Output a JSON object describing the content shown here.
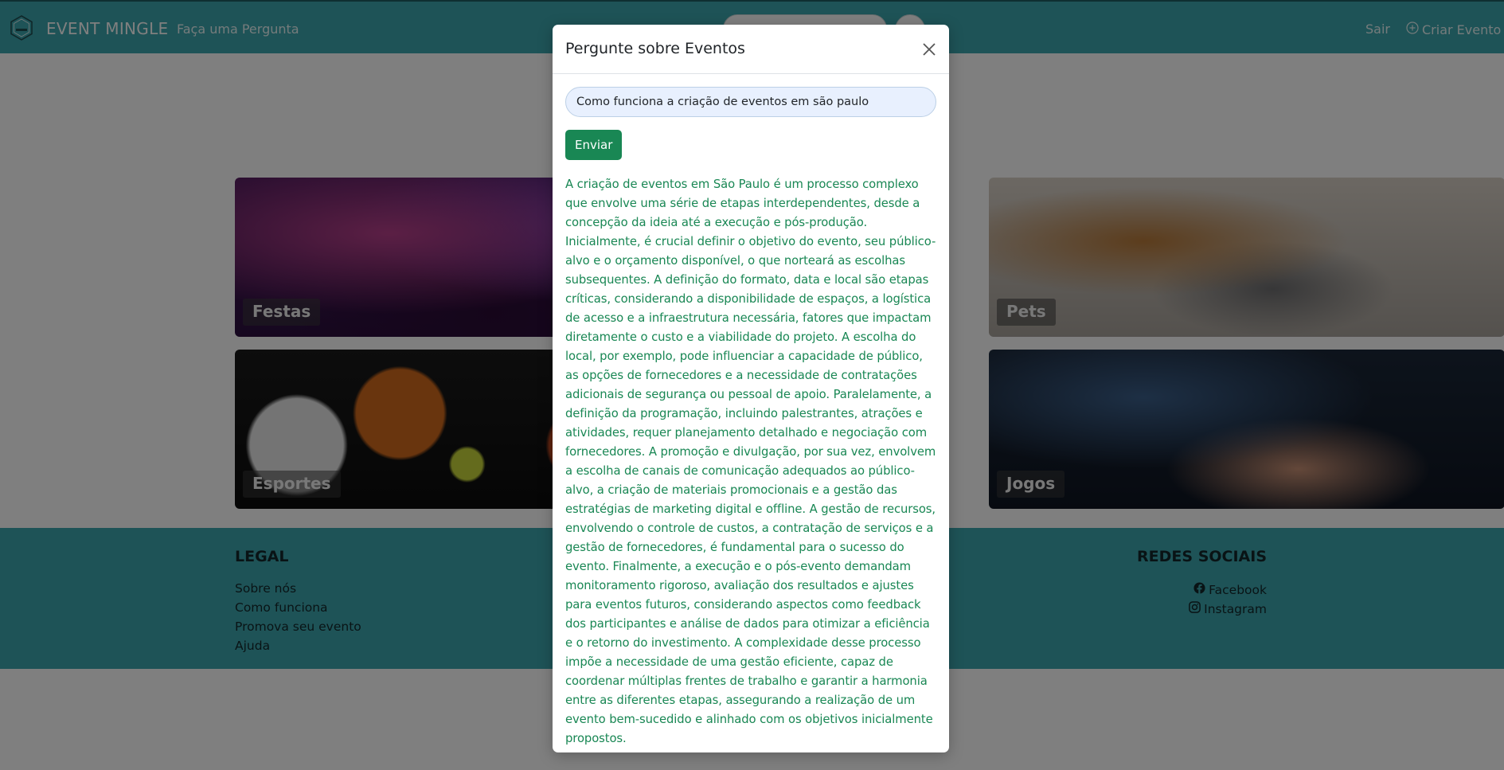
{
  "navbar": {
    "brand": "EVENT MINGLE",
    "ask_link": "Faça uma Pergunta",
    "logout": "Sair",
    "create_event": "Criar Evento"
  },
  "categories": [
    {
      "label": "Festas",
      "image": "party-crowd-image"
    },
    {
      "label": "Pets",
      "image": "dog-and-cat-image"
    },
    {
      "label": "Esportes",
      "image": "sports-balls-image"
    },
    {
      "label": "Jogos",
      "image": "game-controller-image"
    }
  ],
  "footer": {
    "legal_title": "LEGAL",
    "legal_links": [
      "Sobre nós",
      "Como funciona",
      "Promova seu evento",
      "Ajuda"
    ],
    "social_title": "REDES SOCIAIS",
    "social_links": [
      {
        "label": "Facebook",
        "icon": "facebook-icon"
      },
      {
        "label": "Instagram",
        "icon": "instagram-icon"
      }
    ]
  },
  "modal": {
    "title": "Pergunte sobre Eventos",
    "question_value": "Como funciona a criação de eventos em são paulo",
    "send_label": "Enviar",
    "answer": "A criação de eventos em São Paulo é um processo complexo que envolve uma série de etapas interdependentes, desde a concepção da ideia até a execução e pós-produção. Inicialmente, é crucial definir o objetivo do evento, seu público-alvo e o orçamento disponível, o que norteará as escolhas subsequentes. A definição do formato, data e local são etapas críticas, considerando a disponibilidade de espaços, a logística de acesso e a infraestrutura necessária, fatores que impactam diretamente o custo e a viabilidade do projeto. A escolha do local, por exemplo, pode influenciar a capacidade de público, as opções de fornecedores e a necessidade de contratações adicionais de segurança ou pessoal de apoio. Paralelamente, a definição da programação, incluindo palestrantes, atrações e atividades, requer planejamento detalhado e negociação com fornecedores. A promoção e divulgação, por sua vez, envolvem a escolha de canais de comunicação adequados ao público-alvo, a criação de materiais promocionais e a gestão das estratégias de marketing digital e offline. A gestão de recursos, envolvendo o controle de custos, a contratação de serviços e a gestão de fornecedores, é fundamental para o sucesso do evento. Finalmente, a execução e o pós-evento demandam monitoramento rigoroso, avaliação dos resultados e ajustes para eventos futuros, considerando aspectos como feedback dos participantes e análise de dados para otimizar a eficiência e o retorno do investimento. A complexidade desse processo impõe a necessidade de uma gestão eficiente, capaz de coordenar múltiplas frentes de trabalho e garantir a harmonia entre as diferentes etapas, assegurando a realização de um evento bem-sucedido e alinhado com os objetivos inicialmente propostos."
  },
  "colors": {
    "navbar": "#3da7ae",
    "footer": "#3da7ae",
    "send_button": "#198754",
    "answer_text": "#198754"
  }
}
